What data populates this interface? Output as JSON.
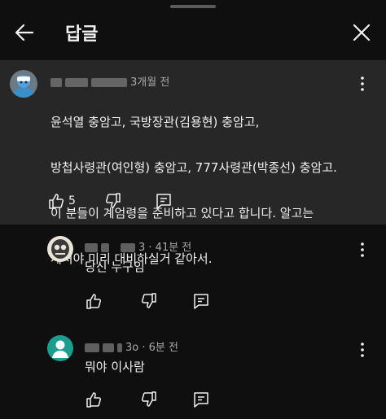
{
  "header": {
    "title": "답글"
  },
  "parent_comment": {
    "meta": "3개월 전",
    "lines": [
      "윤석열 충암고, 국방장관(김용현) 충암고,",
      "방첩사령관(여인형) 충암고, 777사령관(박종선) 충암고.",
      "이 분들이 계엄령을 준비하고 있다고 합니다. 알고는",
      "계셔야 미리 대비하실거 같아서."
    ],
    "like_count": "5"
  },
  "replies": [
    {
      "meta": "3 · 41분 전",
      "text": "당신 누구임"
    },
    {
      "meta": "3o · 6분 전",
      "text": "뭐야 이사람"
    }
  ],
  "icons": [
    "back-arrow-icon",
    "close-icon",
    "more-vert-icon",
    "thumb-up-icon",
    "thumb-down-icon",
    "reply-icon"
  ],
  "colors": {
    "background": "#0f0f0f",
    "highlight": "#272727",
    "text": "#f1f1f1",
    "secondary": "#aaaaaa"
  }
}
